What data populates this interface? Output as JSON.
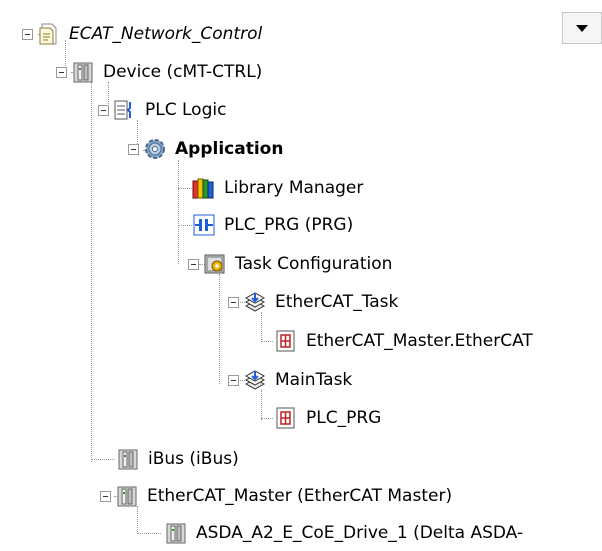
{
  "tree": {
    "nodes": [
      {
        "label": "ECAT_Network_Control",
        "icon": "project-icon"
      },
      {
        "label": "Device (cMT-CTRL)",
        "icon": "device-icon"
      },
      {
        "label": "PLC Logic",
        "icon": "plc-logic-icon"
      },
      {
        "label": "Application",
        "icon": "gear-icon"
      },
      {
        "label": "Library Manager",
        "icon": "library-books-icon"
      },
      {
        "label": "PLC_PRG (PRG)",
        "icon": "program-icon"
      },
      {
        "label": "Task Configuration",
        "icon": "task-config-icon"
      },
      {
        "label": "EtherCAT_Task",
        "icon": "task-icon"
      },
      {
        "label": "EtherCAT_Master.EtherCAT",
        "icon": "call-icon"
      },
      {
        "label": "MainTask",
        "icon": "task-icon"
      },
      {
        "label": "PLC_PRG",
        "icon": "call-icon"
      },
      {
        "label": "iBus (iBus)",
        "icon": "device-icon"
      },
      {
        "label": "EtherCAT_Master (EtherCAT Master)",
        "icon": "device-icon"
      },
      {
        "label": "ASDA_A2_E_CoE_Drive_1 (Delta ASDA-",
        "icon": "device-icon"
      }
    ]
  },
  "dropdown": {
    "icon": "chevron-down-icon"
  }
}
